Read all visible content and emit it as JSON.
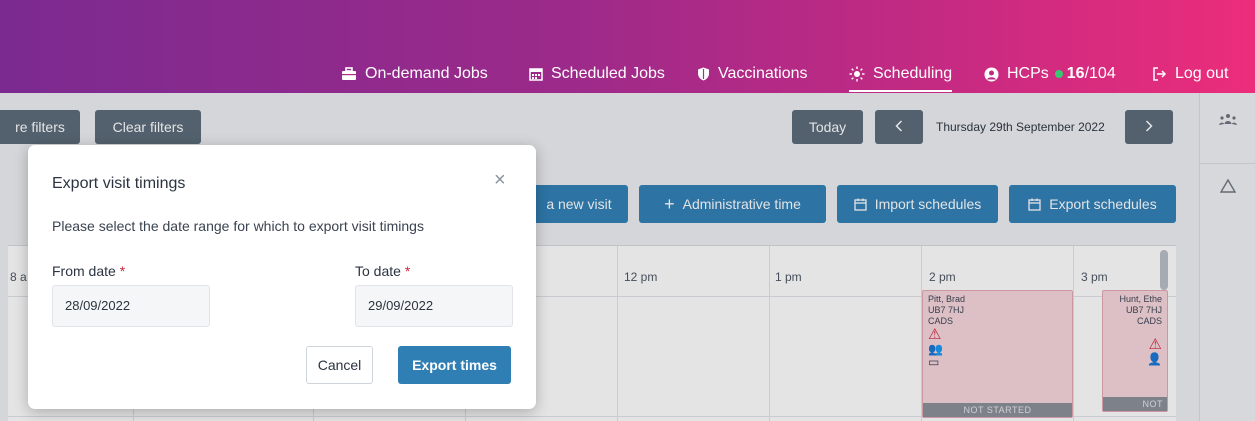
{
  "nav": {
    "items": [
      {
        "label": "On-demand Jobs",
        "icon": "briefcase-icon"
      },
      {
        "label": "Scheduled Jobs",
        "icon": "calendar-icon"
      },
      {
        "label": "Vaccinations",
        "icon": "shield-icon"
      },
      {
        "label": "Scheduling",
        "icon": "sun-icon",
        "active": true
      },
      {
        "label": "HCPs",
        "icon": "user-icon",
        "online": "16",
        "total": "/104"
      },
      {
        "label": "Log out",
        "icon": "logout-icon"
      }
    ]
  },
  "toolbar": {
    "more_filters": "re filters",
    "clear_filters": "Clear filters",
    "today": "Today",
    "prev": "<",
    "next": ">",
    "current_date": "Thursday 29th September 2022"
  },
  "actions": {
    "new_visit": "a new visit",
    "admin_time": "Administrative time",
    "admin_time_icon": "+",
    "import_schedules": "Import schedules",
    "export_schedules": "Export schedules"
  },
  "schedule": {
    "times": [
      "8 a",
      "12 pm",
      "1 pm",
      "2 pm",
      "3 pm"
    ],
    "visits": [
      {
        "name": "Pitt, Brad",
        "postcode": "UB7 7HJ",
        "type": "CADS",
        "status": "NOT STARTED"
      },
      {
        "name": "Hunt, Ethe",
        "postcode": "UB7 7HJ",
        "type": "CADS",
        "status": "NOT"
      }
    ]
  },
  "modal": {
    "title": "Export visit timings",
    "description": "Please select the date range for which to export visit timings",
    "from_label": "From date",
    "to_label": "To date",
    "required_mark": "*",
    "from_value": "28/09/2022",
    "to_value": "29/09/2022",
    "cancel": "Cancel",
    "export": "Export times"
  },
  "colors": {
    "header_gradient_start": "#7b2a90",
    "header_gradient_end": "#ec2d7b",
    "primary_button": "#2f7fb5",
    "dark_button": "#5b6a78",
    "required": "#d0243a",
    "online_dot": "#37c871"
  }
}
